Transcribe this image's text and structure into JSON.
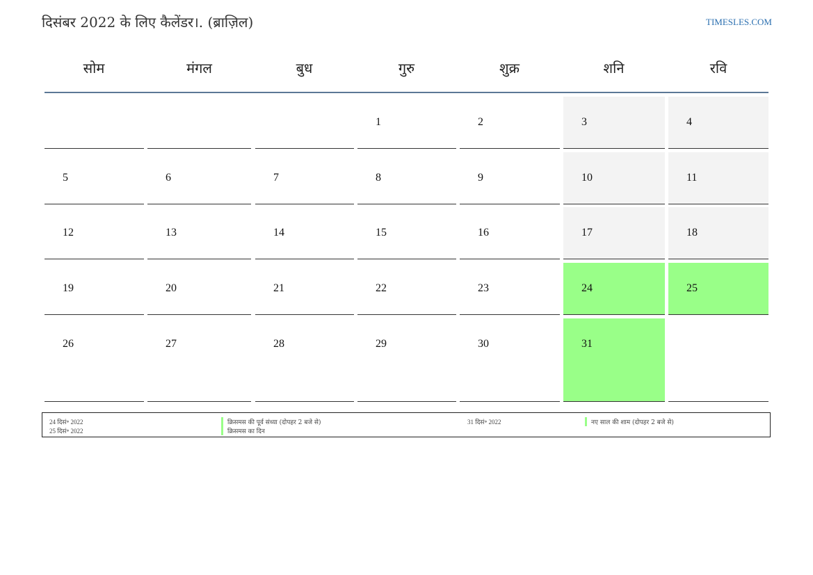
{
  "header": {
    "title": "दिसंबर 2022 के लिए कैलेंडर।. (ब्राज़िल)",
    "site": "TIMESLES.COM"
  },
  "weekdays": [
    "सोम",
    "मंगल",
    "बुध",
    "गुरु",
    "शुक्र",
    "शनि",
    "रवि"
  ],
  "weeks": [
    [
      "",
      "",
      "",
      "1",
      "2",
      "3",
      "4"
    ],
    [
      "5",
      "6",
      "7",
      "8",
      "9",
      "10",
      "11"
    ],
    [
      "12",
      "13",
      "14",
      "15",
      "16",
      "17",
      "18"
    ],
    [
      "19",
      "20",
      "21",
      "22",
      "23",
      "24",
      "25"
    ],
    [
      "26",
      "27",
      "28",
      "29",
      "30",
      "31",
      ""
    ]
  ],
  "highlighted_days": [
    "24",
    "25",
    "31"
  ],
  "colors": {
    "holiday": "#99ff88",
    "weekend": "#f3f3f3",
    "accent": "#5b7796",
    "link": "#2b6fb0"
  },
  "holidays": [
    {
      "date": "24 दिसं॰ 2022",
      "name": "क्रिसमस की पूर्व संध्या (दोपहर 2 बजे से)"
    },
    {
      "date": "25 दिसं॰ 2022",
      "name": "क्रिसमस का दिन"
    },
    {
      "date": "31 दिसं॰ 2022",
      "name": "नए साल की शाम (दोपहर 2 बजे से)"
    }
  ]
}
